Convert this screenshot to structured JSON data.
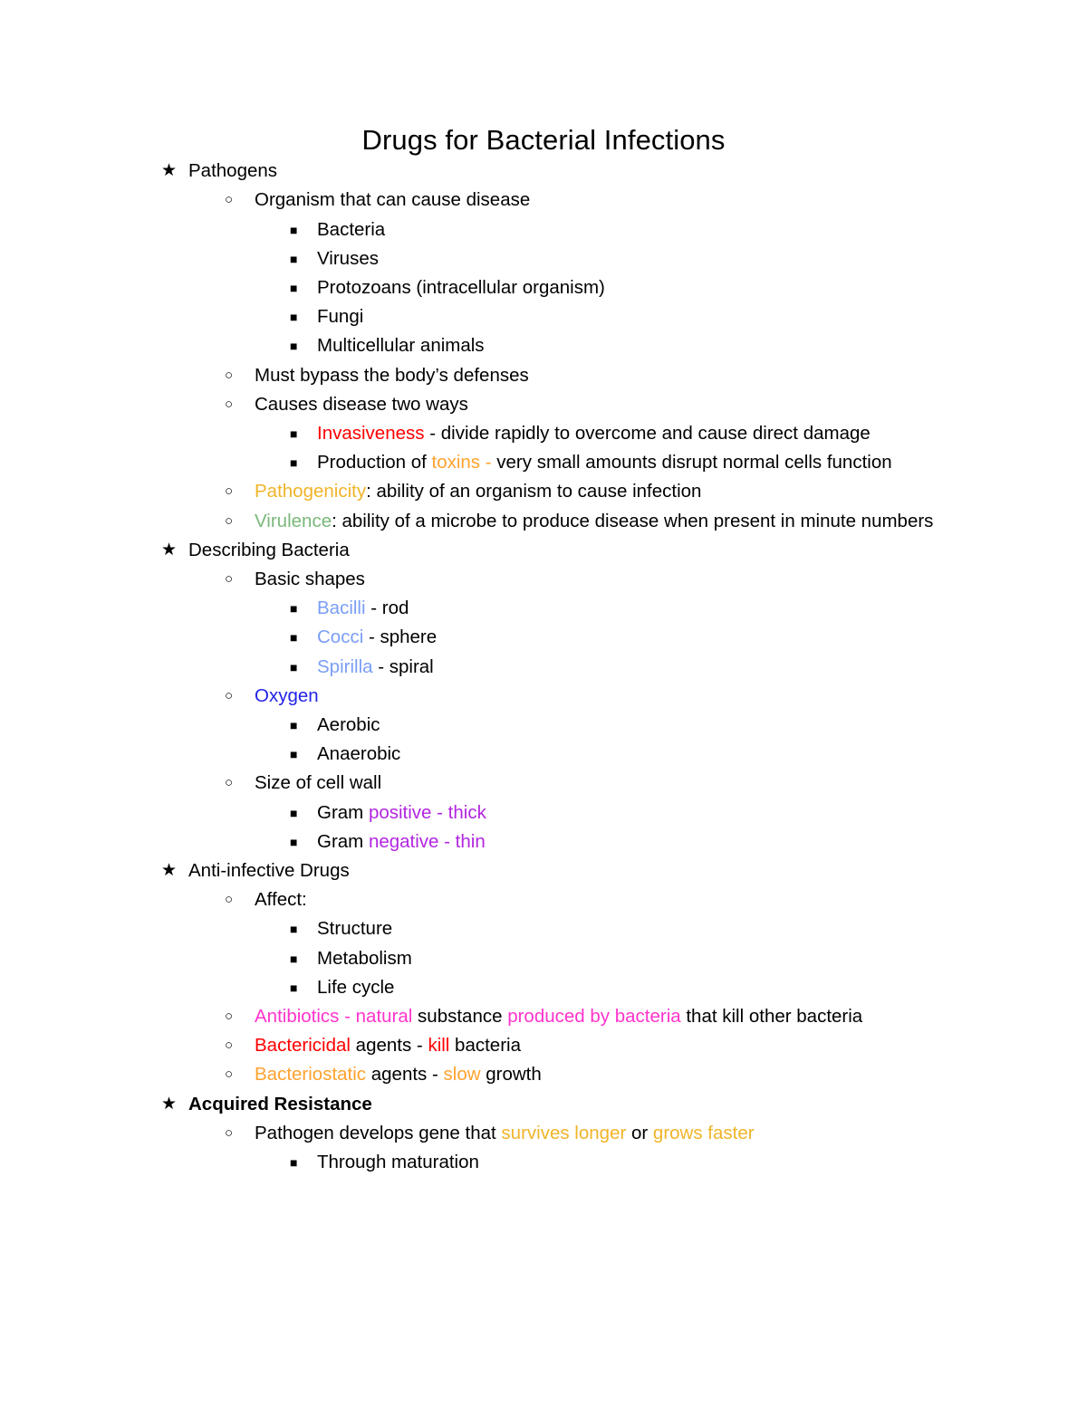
{
  "document": {
    "title": "Drugs for Bacterial Infections"
  },
  "colors": {
    "red": "#ff0000",
    "orange": "#ffa22e",
    "gold": "#f0b429",
    "green": "#7ab87a",
    "blue_light": "#7a9ef5",
    "blue": "#2222e8",
    "purple": "#b225e0",
    "magenta": "#ff33cc",
    "text": "#000000",
    "background": "#ffffff"
  },
  "bullets": {
    "level1": "★",
    "level2": "○",
    "level3": "■"
  },
  "outline": {
    "pathogens": {
      "heading": "Pathogens",
      "organism": "Organism that can cause disease",
      "organism_types": [
        "Bacteria",
        "Viruses",
        "Protozoans (intracellular organism)",
        "Fungi",
        "Multicellular animals"
      ],
      "bypass": "Must bypass the body’s defenses",
      "causes": "Causes disease two ways",
      "invasiveness_key": "Invasiveness",
      "invasiveness_rest": " - divide rapidly to overcome and cause direct damage",
      "production_pre": "Production of ",
      "toxins_key": "toxins -",
      "production_rest": " very small amounts disrupt normal cells function",
      "pathogenicity_key": "Pathogenicity",
      "pathogenicity_rest": ": ability of an organism to cause infection",
      "virulence_key": "Virulence",
      "virulence_rest": ": ability of a microbe to produce disease when present in minute numbers"
    },
    "describing_bacteria": {
      "heading": "Describing Bacteria",
      "basic_shapes": "Basic shapes",
      "shapes": [
        {
          "key": "Bacilli",
          "rest": " - rod"
        },
        {
          "key": "Cocci",
          "rest": " - sphere"
        },
        {
          "key": "Spirilla",
          "rest": " - spiral"
        }
      ],
      "oxygen": "Oxygen",
      "oxygen_types": [
        "Aerobic",
        "Anaerobic"
      ],
      "size_of_cell_wall": "Size of cell wall",
      "gram_prefix": "Gram ",
      "gram_positive": "positive - thick",
      "gram_negative": "negative - thin"
    },
    "anti_infective_drugs": {
      "heading": "Anti-infective Drugs",
      "affect": "Affect:",
      "affect_items": [
        "Structure",
        "Metabolism",
        "Life cycle"
      ],
      "antibiotics_key": "Antibiotics - natural",
      "antibiotics_mid": " substance ",
      "antibiotics_key2": "produced by bacteria",
      "antibiotics_rest": " that kill other bacteria",
      "bactericidal_key": "Bactericidal",
      "bactericidal_mid": " agents - ",
      "bactericidal_key2": "kill",
      "bactericidal_rest": " bacteria",
      "bacteriostatic_key": "Bacteriostatic",
      "bacteriostatic_mid": " agents - ",
      "bacteriostatic_key2": "slow",
      "bacteriostatic_rest": " growth"
    },
    "acquired_resistance": {
      "heading": "Acquired Resistance",
      "pathogen_pre": "Pathogen develops gene that ",
      "survives_longer": "survives longer",
      "pathogen_mid": " or ",
      "grows_faster": "grows faster",
      "through_maturation": "Through maturation"
    }
  }
}
